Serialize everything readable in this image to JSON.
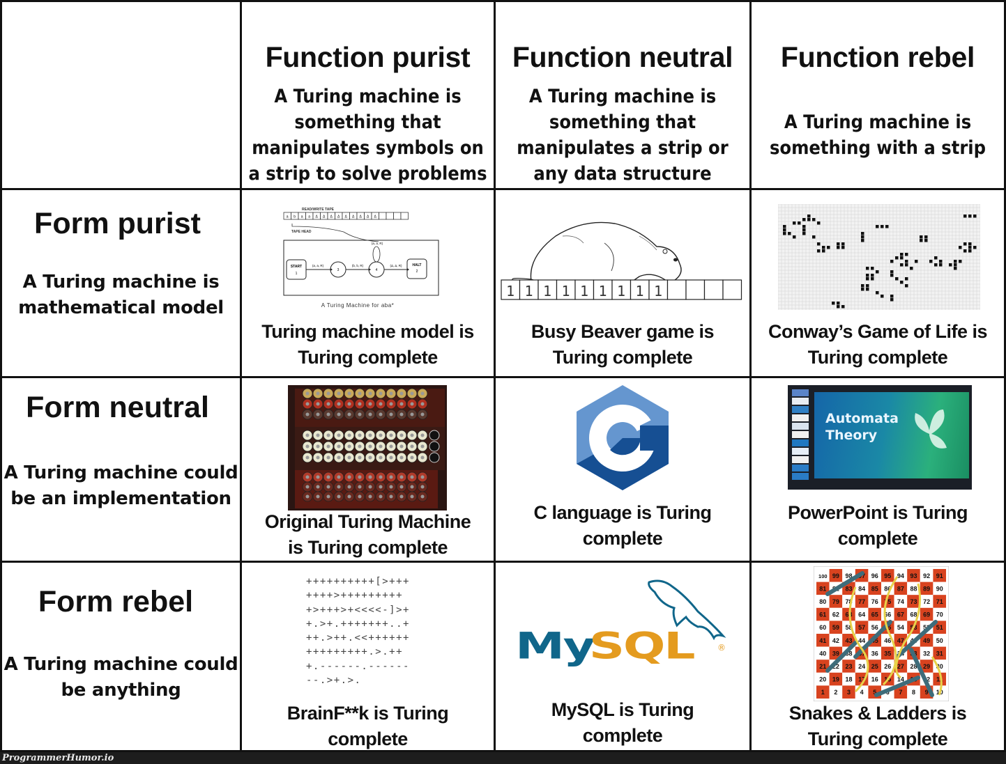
{
  "columns": [
    {
      "title": "Function purist",
      "desc": [
        "A Turing machine is",
        "something that",
        "manipulates symbols on",
        "a strip to solve problems"
      ]
    },
    {
      "title": "Function neutral",
      "desc": [
        "A Turing machine is",
        "something that",
        "manipulates  a strip or",
        "any data structure"
      ]
    },
    {
      "title": "Function rebel",
      "desc": [
        "A Turing machine is",
        "something with a strip"
      ]
    }
  ],
  "rows": [
    {
      "title": "Form purist",
      "desc": [
        "A Turing machine is",
        "mathematical model"
      ]
    },
    {
      "title": "Form neutral",
      "desc": [
        "A Turing machine could",
        "be an implementation"
      ]
    },
    {
      "title": "Form rebel",
      "desc": [
        "A Turing machine could",
        "be anything"
      ]
    }
  ],
  "cells": [
    [
      {
        "image": "turing-machine-diagram",
        "caption": [
          "Turing machine model is",
          "Turing complete"
        ]
      },
      {
        "image": "busy-beaver-illustration",
        "caption": [
          "Busy Beaver game is",
          "Turing complete"
        ]
      },
      {
        "image": "game-of-life-grid",
        "caption": [
          "Conway’s Game of Life is",
          "Turing complete"
        ]
      }
    ],
    [
      {
        "image": "bombe-machine-photo",
        "caption": [
          "Original Turing Machine",
          "is Turing complete"
        ]
      },
      {
        "image": "c-language-logo",
        "caption": [
          "C language is Turing",
          "complete"
        ]
      },
      {
        "image": "powerpoint-screenshot",
        "caption": [
          "PowerPoint is Turing",
          "complete"
        ]
      }
    ],
    [
      {
        "image": "brainfuck-code",
        "caption": [
          "BrainF**k is Turing",
          "complete"
        ]
      },
      {
        "image": "mysql-logo",
        "caption": [
          "MySQL is Turing",
          "complete"
        ]
      },
      {
        "image": "snakes-and-ladders-board",
        "caption": [
          "Snakes & Ladders is",
          "Turing complete"
        ]
      }
    ]
  ],
  "tm_diagram": {
    "tape_label": "READ/WRITE TAPE",
    "head_label": "TAPE HEAD",
    "tape": [
      "a",
      "b",
      "a",
      "a",
      "Δ",
      "Δ",
      "Δ",
      "Δ",
      "Δ",
      "Δ",
      "Δ",
      "Δ",
      "Δ",
      "",
      "",
      "",
      ""
    ],
    "states": {
      "start": "START",
      "start_num": "1",
      "s2": "3",
      "s3": "4",
      "halt": "HALT",
      "halt_num": "2"
    },
    "edges": [
      "(a, a, R)",
      "(b, b, R)",
      "(a, a, R)",
      "(Δ, Δ, R)"
    ],
    "caption": "A Turing Machine for aba*"
  },
  "beaver_tape": [
    "1",
    "1",
    "1",
    "1",
    "1",
    "1",
    "1",
    "1",
    "1",
    "",
    "",
    "",
    ""
  ],
  "ppt": {
    "title_line1": "Automata",
    "title_line2": "Theory"
  },
  "brainfuck_lines": [
    "++++++++++[>+++",
    "++++>+++++++++",
    "+>+++>+<<<<-]>+",
    "+.>+.+++++++..+",
    "++.>++.<<++++++",
    "+++++++++.>.++",
    "+.------.------",
    "--.>+.>."
  ],
  "mysql": {
    "my": "My",
    "sql": "SQL",
    "reg": "®"
  },
  "snakes_board": [
    [
      100,
      99,
      98,
      97,
      96,
      95,
      94,
      93,
      92,
      91
    ],
    [
      81,
      82,
      83,
      84,
      85,
      86,
      87,
      88,
      89,
      90
    ],
    [
      80,
      79,
      78,
      77,
      76,
      75,
      74,
      73,
      72,
      71
    ],
    [
      61,
      62,
      63,
      64,
      65,
      66,
      67,
      68,
      69,
      70
    ],
    [
      60,
      59,
      58,
      57,
      56,
      55,
      54,
      53,
      52,
      51
    ],
    [
      41,
      42,
      43,
      44,
      45,
      46,
      47,
      48,
      49,
      50
    ],
    [
      40,
      39,
      38,
      37,
      36,
      35,
      34,
      33,
      32,
      31
    ],
    [
      21,
      22,
      23,
      24,
      25,
      26,
      27,
      28,
      29,
      30
    ],
    [
      20,
      19,
      18,
      17,
      16,
      15,
      14,
      13,
      12,
      11
    ],
    [
      1,
      2,
      3,
      4,
      5,
      6,
      7,
      8,
      9,
      10
    ]
  ],
  "colors": {
    "board_red": "#d8431f",
    "c_light": "#6596cf",
    "c_dark": "#164f93",
    "mysql_blue": "#10668a",
    "mysql_orange": "#e49b1f"
  },
  "footer": {
    "watermark": "ProgrammerHumor.io"
  }
}
